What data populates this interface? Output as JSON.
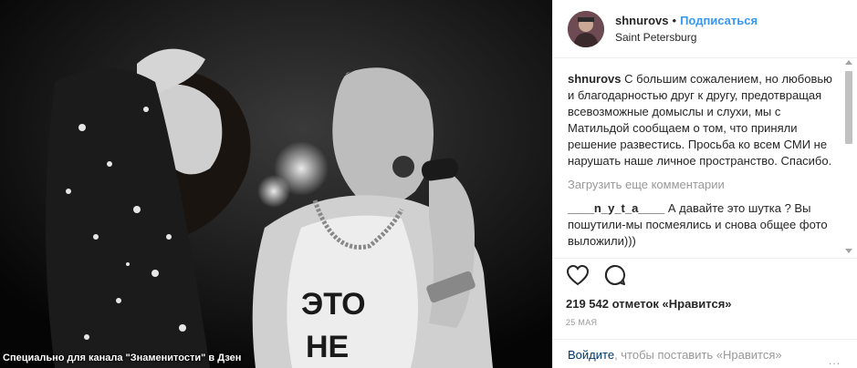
{
  "photo": {
    "watermark": "Специально для канала \"Знаменитости\" в Дзен",
    "shirt_text_1": "ЭТО",
    "shirt_text_2": "НЕ"
  },
  "header": {
    "username": "shnurovs",
    "separator": "•",
    "follow_label": "Подписаться",
    "location": "Saint Petersburg"
  },
  "comments": {
    "caption_user": "shnurovs",
    "caption_text": "С большим сожалением, но любовью и благодарностью друг к другу, предотвращая всевозможные домыслы и слухи, мы с Матильдой сообщаем о том, что приняли решение развестись. Просьба ко всем СМИ не нарушать наше личное пространство. Спасибо.",
    "load_more": "Загрузить еще комментарии",
    "comment_user": "____n_y_t_a____",
    "comment_text": "А давайте это шутка ? Вы пошутили-мы посмеялись и снова общее фото выложили)))"
  },
  "actions": {
    "like_icon": "heart-icon",
    "comment_icon": "speech-bubble-icon",
    "likes_text": "219 542 отметок «Нравится»",
    "date": "25 МАЯ"
  },
  "login": {
    "login_link": "Войдите",
    "login_text": ", чтобы поставить «Нравится»",
    "more": "..."
  },
  "colors": {
    "accent": "#3897f0",
    "text": "#262626",
    "muted": "#999999",
    "border": "#efefef"
  }
}
